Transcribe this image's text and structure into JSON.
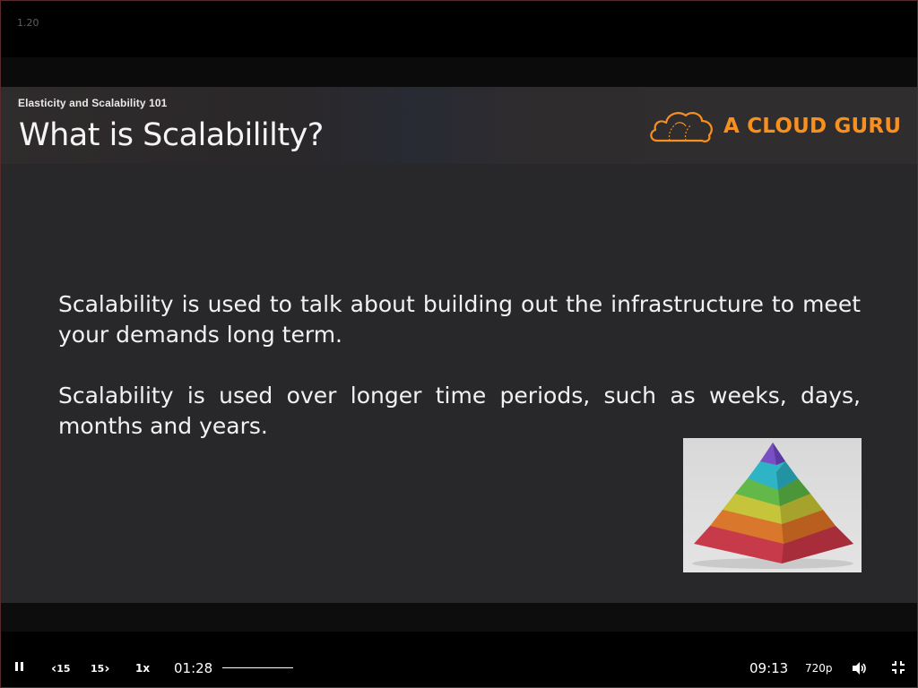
{
  "player": {
    "top_label": "1.20"
  },
  "slide": {
    "course_title": "Elasticity and Scalability 101",
    "title": "What is Scalabililty?",
    "brand": "A CLOUD GURU",
    "paragraphs": [
      "Scalability is used to talk about building out the infrastructure to meet your demands long term.",
      "Scalability is used over longer time periods, such as weeks, days, months and years."
    ],
    "brand_color": "#f7901e"
  },
  "controls": {
    "rewind_label": "15",
    "forward_label": "15",
    "speed_label": "1x",
    "current_time": "01:28",
    "duration": "09:13",
    "quality_label": "720p",
    "icons": {
      "play_state": "pause-icon",
      "rewind": "rewind-15-icon",
      "forward": "forward-15-icon",
      "volume": "volume-icon",
      "fullscreen": "exit-fullscreen-icon"
    }
  }
}
